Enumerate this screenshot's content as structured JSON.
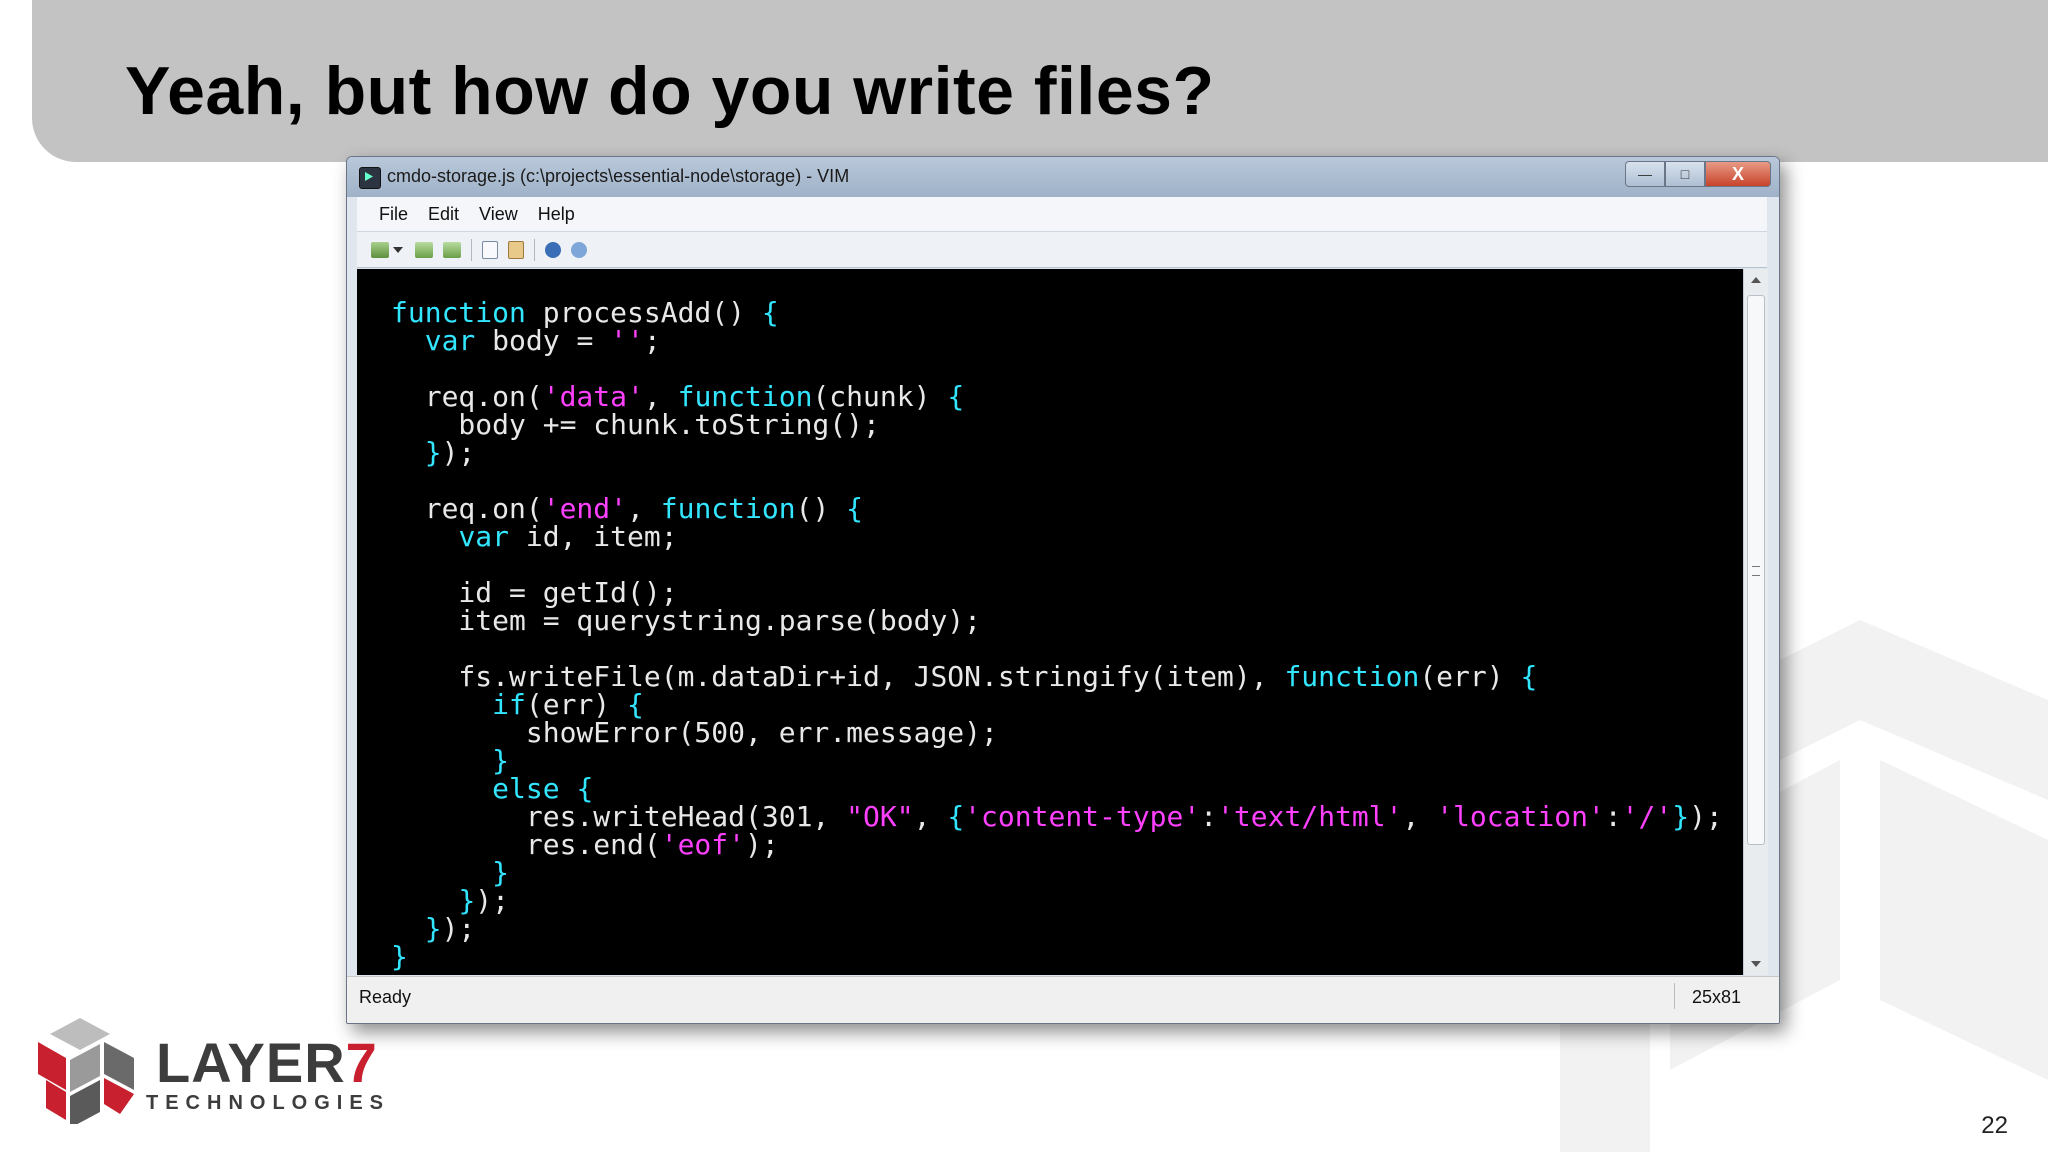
{
  "slide": {
    "title": "Yeah, but how do you write files?",
    "page_number": "22"
  },
  "window": {
    "title": "cmdo-storage.js (c:\\projects\\essential-node\\storage) - VIM",
    "minimize_label": "—",
    "maximize_label": "□",
    "close_label": "X",
    "menu": [
      "File",
      "Edit",
      "View",
      "Help"
    ],
    "toolbar_icons": [
      "new-session-icon",
      "dropdown-arrow-icon",
      "back-icon",
      "forward-icon",
      "copy-icon",
      "paste-icon",
      "info-icon",
      "help-icon"
    ],
    "status": "Ready",
    "cursor_position": "25x81"
  },
  "code_lines": [
    [
      {
        "t": "function",
        "c": "kw"
      },
      {
        "t": " processAdd() ",
        "c": "plain"
      },
      {
        "t": "{",
        "c": "kw"
      }
    ],
    [
      {
        "t": "  ",
        "c": "plain"
      },
      {
        "t": "var",
        "c": "kw"
      },
      {
        "t": " body = ",
        "c": "plain"
      },
      {
        "t": "''",
        "c": "str"
      },
      {
        "t": ";",
        "c": "plain"
      }
    ],
    [],
    [
      {
        "t": "  req.on(",
        "c": "plain"
      },
      {
        "t": "'data'",
        "c": "str"
      },
      {
        "t": ", ",
        "c": "plain"
      },
      {
        "t": "function",
        "c": "kw"
      },
      {
        "t": "(chunk) ",
        "c": "plain"
      },
      {
        "t": "{",
        "c": "kw"
      }
    ],
    [
      {
        "t": "    body += chunk.toString();",
        "c": "plain"
      }
    ],
    [
      {
        "t": "  ",
        "c": "plain"
      },
      {
        "t": "}",
        "c": "kw"
      },
      {
        "t": ");",
        "c": "plain"
      }
    ],
    [],
    [
      {
        "t": "  req.on(",
        "c": "plain"
      },
      {
        "t": "'end'",
        "c": "str"
      },
      {
        "t": ", ",
        "c": "plain"
      },
      {
        "t": "function",
        "c": "kw"
      },
      {
        "t": "() ",
        "c": "plain"
      },
      {
        "t": "{",
        "c": "kw"
      }
    ],
    [
      {
        "t": "    ",
        "c": "plain"
      },
      {
        "t": "var",
        "c": "kw"
      },
      {
        "t": " id, item;",
        "c": "plain"
      }
    ],
    [],
    [
      {
        "t": "    id = getId();",
        "c": "plain"
      }
    ],
    [
      {
        "t": "    item = querystring.parse(body);",
        "c": "plain"
      }
    ],
    [],
    [
      {
        "t": "    fs.writeFile(m.dataDir+id, JSON.stringify(item), ",
        "c": "plain"
      },
      {
        "t": "function",
        "c": "kw"
      },
      {
        "t": "(err) ",
        "c": "plain"
      },
      {
        "t": "{",
        "c": "kw"
      }
    ],
    [
      {
        "t": "      ",
        "c": "plain"
      },
      {
        "t": "if",
        "c": "kw"
      },
      {
        "t": "(err) ",
        "c": "plain"
      },
      {
        "t": "{",
        "c": "kw"
      }
    ],
    [
      {
        "t": "        showError(500, err.message);",
        "c": "plain"
      }
    ],
    [
      {
        "t": "      ",
        "c": "plain"
      },
      {
        "t": "}",
        "c": "kw"
      }
    ],
    [
      {
        "t": "      ",
        "c": "plain"
      },
      {
        "t": "else",
        "c": "kw"
      },
      {
        "t": " ",
        "c": "plain"
      },
      {
        "t": "{",
        "c": "kw"
      }
    ],
    [
      {
        "t": "        res.writeHead(301, ",
        "c": "plain"
      },
      {
        "t": "\"OK\"",
        "c": "str"
      },
      {
        "t": ", ",
        "c": "plain"
      },
      {
        "t": "{",
        "c": "kw"
      },
      {
        "t": "'content-type'",
        "c": "str"
      },
      {
        "t": ":",
        "c": "plain"
      },
      {
        "t": "'text/html'",
        "c": "str"
      },
      {
        "t": ", ",
        "c": "plain"
      },
      {
        "t": "'location'",
        "c": "str"
      },
      {
        "t": ":",
        "c": "plain"
      },
      {
        "t": "'/'",
        "c": "str"
      },
      {
        "t": "}",
        "c": "kw"
      },
      {
        "t": ");",
        "c": "plain"
      }
    ],
    [
      {
        "t": "        res.end(",
        "c": "plain"
      },
      {
        "t": "'eof'",
        "c": "str"
      },
      {
        "t": ");",
        "c": "plain"
      }
    ],
    [
      {
        "t": "      ",
        "c": "plain"
      },
      {
        "t": "}",
        "c": "kw"
      }
    ],
    [
      {
        "t": "    ",
        "c": "plain"
      },
      {
        "t": "}",
        "c": "kw"
      },
      {
        "t": ");",
        "c": "plain"
      }
    ],
    [
      {
        "t": "  ",
        "c": "plain"
      },
      {
        "t": "}",
        "c": "kw"
      },
      {
        "t": ");",
        "c": "plain"
      }
    ],
    [
      {
        "t": "}",
        "c": "kw"
      }
    ]
  ],
  "colors": {
    "keyword": "#33e6ff",
    "string": "#ff40ff",
    "plain": "#e8e8e8",
    "editor_bg": "#000000",
    "brand_red": "#c8202e"
  },
  "logo": {
    "name_main": "LAYER",
    "name_digit": "7",
    "subtitle": "TECHNOLOGIES"
  }
}
